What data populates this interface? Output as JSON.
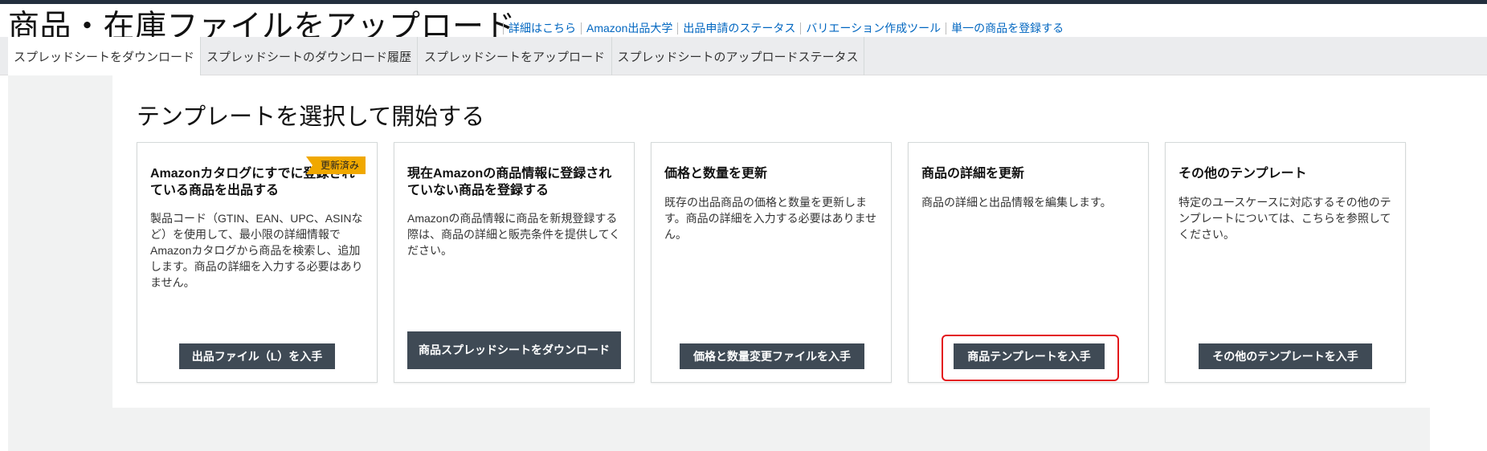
{
  "page": {
    "title": "商品・在庫ファイルをアップロード",
    "header_links": [
      "詳細はこちら",
      "Amazon出品大学",
      "出品申請のステータス",
      "バリエーション作成ツール",
      "単一の商品を登録する"
    ]
  },
  "tabs": [
    {
      "label": "スプレッドシートをダウンロード",
      "active": true
    },
    {
      "label": "スプレッドシートのダウンロード履歴",
      "active": false
    },
    {
      "label": "スプレッドシートをアップロード",
      "active": false
    },
    {
      "label": "スプレッドシートのアップロードステータス",
      "active": false
    }
  ],
  "section": {
    "title": "テンプレートを選択して開始する"
  },
  "cards": [
    {
      "title": "Amazonカタログにすでに登録されている商品を出品する",
      "description": "製品コード（GTIN、EAN、UPC、ASINなど）を使用して、最小限の詳細情報でAmazonカタログから商品を検索し、追加します。商品の詳細を入力する必要はありません。",
      "badge": "更新済み",
      "button": "出品ファイル（L）を入手"
    },
    {
      "title": "現在Amazonの商品情報に登録されていない商品を登録する",
      "description": "Amazonの商品情報に商品を新規登録する際は、商品の詳細と販売条件を提供してください。",
      "button": "商品スプレッドシートをダウンロード"
    },
    {
      "title": "価格と数量を更新",
      "description": "既存の出品商品の価格と数量を更新します。商品の詳細を入力する必要はありません。",
      "button": "価格と数量変更ファイルを入手"
    },
    {
      "title": "商品の詳細を更新",
      "description": "商品の詳細と出品情報を編集します。",
      "button": "商品テンプレートを入手"
    },
    {
      "title": "その他のテンプレート",
      "description": "特定のユースケースに対応するその他のテンプレートについては、こちらを参照してください。",
      "button": "その他のテンプレートを入手"
    }
  ],
  "colors": {
    "accent": "#008296",
    "link": "#0066c0",
    "button": "#3f4a55",
    "badge": "#f0a800",
    "highlight": "#e3151a"
  }
}
